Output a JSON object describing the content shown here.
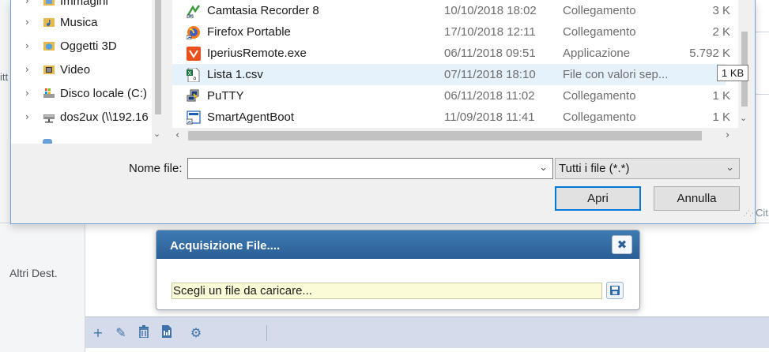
{
  "background": {
    "left_clipped_text": "itt",
    "altri_dest_label": "Altri Dest.",
    "right_clipped_text": "Cit",
    "toolbar": {
      "icons": [
        "plus-icon",
        "pencil-icon",
        "trash-icon",
        "document-icon",
        "gear-icon"
      ]
    }
  },
  "file_dialog": {
    "nav_items": [
      {
        "label": "Immagini",
        "icon": "pictures-folder-icon"
      },
      {
        "label": "Musica",
        "icon": "music-folder-icon"
      },
      {
        "label": "Oggetti 3D",
        "icon": "3d-objects-folder-icon"
      },
      {
        "label": "Video",
        "icon": "video-folder-icon"
      },
      {
        "label": "Disco locale (C:)",
        "icon": "local-disk-icon"
      },
      {
        "label": "dos2ux (\\\\192.16",
        "icon": "network-drive-icon"
      }
    ],
    "files": [
      {
        "name": "Camtasia Recorder 8",
        "date": "10/10/2018 18:02",
        "type": "Collegamento",
        "size": "3 K",
        "icon": "camtasia-icon"
      },
      {
        "name": "Firefox Portable",
        "date": "17/10/2018 12:11",
        "type": "Collegamento",
        "size": "2 K",
        "icon": "firefox-icon"
      },
      {
        "name": "IperiusRemote.exe",
        "date": "06/11/2018 09:51",
        "type": "Applicazione",
        "size": "5.792 K",
        "icon": "iperius-remote-icon"
      },
      {
        "name": "Lista 1.csv",
        "date": "07/11/2018 18:10",
        "type": "File con valori sep...",
        "size": "",
        "icon": "csv-file-icon"
      },
      {
        "name": "PuTTY",
        "date": "06/11/2018 11:02",
        "type": "Collegamento",
        "size": "1 K",
        "icon": "putty-icon"
      },
      {
        "name": "SmartAgentBoot",
        "date": "11/09/2018 11:41",
        "type": "Collegamento",
        "size": "1 K",
        "icon": "smartagent-icon"
      }
    ],
    "selected_index": 3,
    "tooltip": "1 KB",
    "filename_label": "Nome file:",
    "filename_value": "",
    "filter_value": "Tutti i file (*.*)",
    "open_button": "Apri",
    "cancel_button": "Annulla"
  },
  "acquisition_modal": {
    "title": "Acquisizione File....",
    "close_glyph": "✖",
    "field_text": "Scegli un file da caricare...",
    "colors": {
      "header": "#2f6aa6",
      "field_bg": "#fbfbd8"
    }
  }
}
